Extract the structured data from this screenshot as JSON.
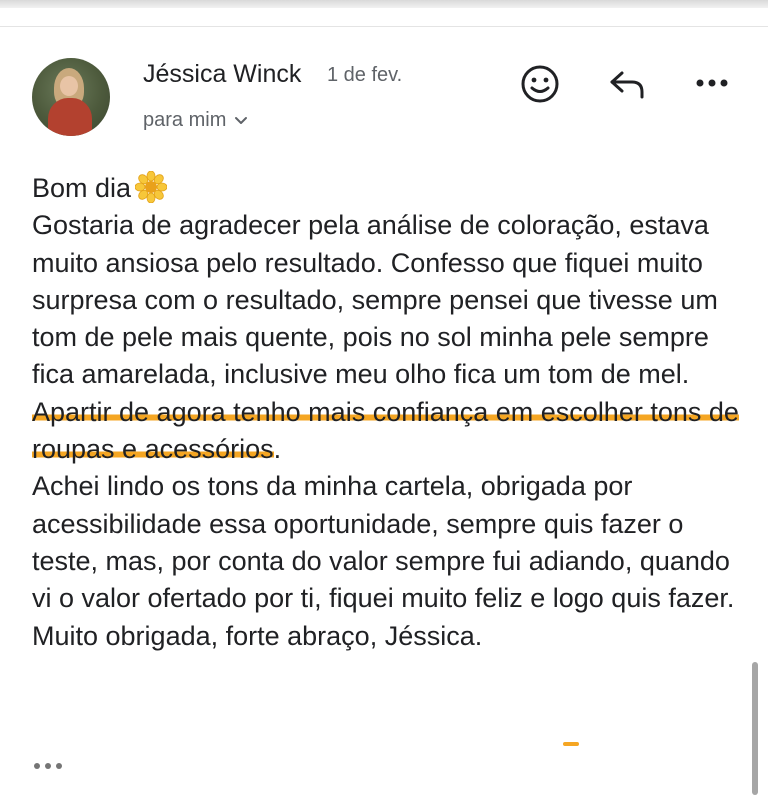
{
  "email": {
    "sender_name": "Jéssica Winck",
    "date": "1 de fev.",
    "recipient": "para mim",
    "greeting": "Bom dia",
    "body_before": "Gostaria de agradecer pela análise de coloração, estava muito ansiosa pelo resultado. Confesso que fiquei muito surpresa com o resultado, sempre pensei que tivesse um tom de pele mais quente, pois no sol minha pele sempre fica amarelada, inclusive meu olho fica um tom de mel. ",
    "body_highlight": "Apartir de agora tenho mais confiança em escolher tons de roupas e acessórios",
    "body_after": ".\nAchei lindo os tons da minha cartela, obrigada por acessibilidade essa oportunidade, sempre quis fazer o teste, mas, por conta do valor sempre fui adiando, quando vi o valor ofertado por ti, fiquei muito feliz e logo quis fazer.\nMuito obrigada, forte abraço, Jéssica."
  },
  "icons": {
    "avatar": "profile-photo",
    "react": "smiley-face-icon",
    "reply": "reply-arrow-icon",
    "more": "more-horizontal-icon",
    "recipient_expand": "chevron-down-icon",
    "greeting_emoji": "sunflower-icon",
    "trimmed_content": "ellipsis-icon"
  },
  "colors": {
    "highlight": "#f5a623",
    "text": "#202124",
    "secondary_text": "#5f6368"
  }
}
